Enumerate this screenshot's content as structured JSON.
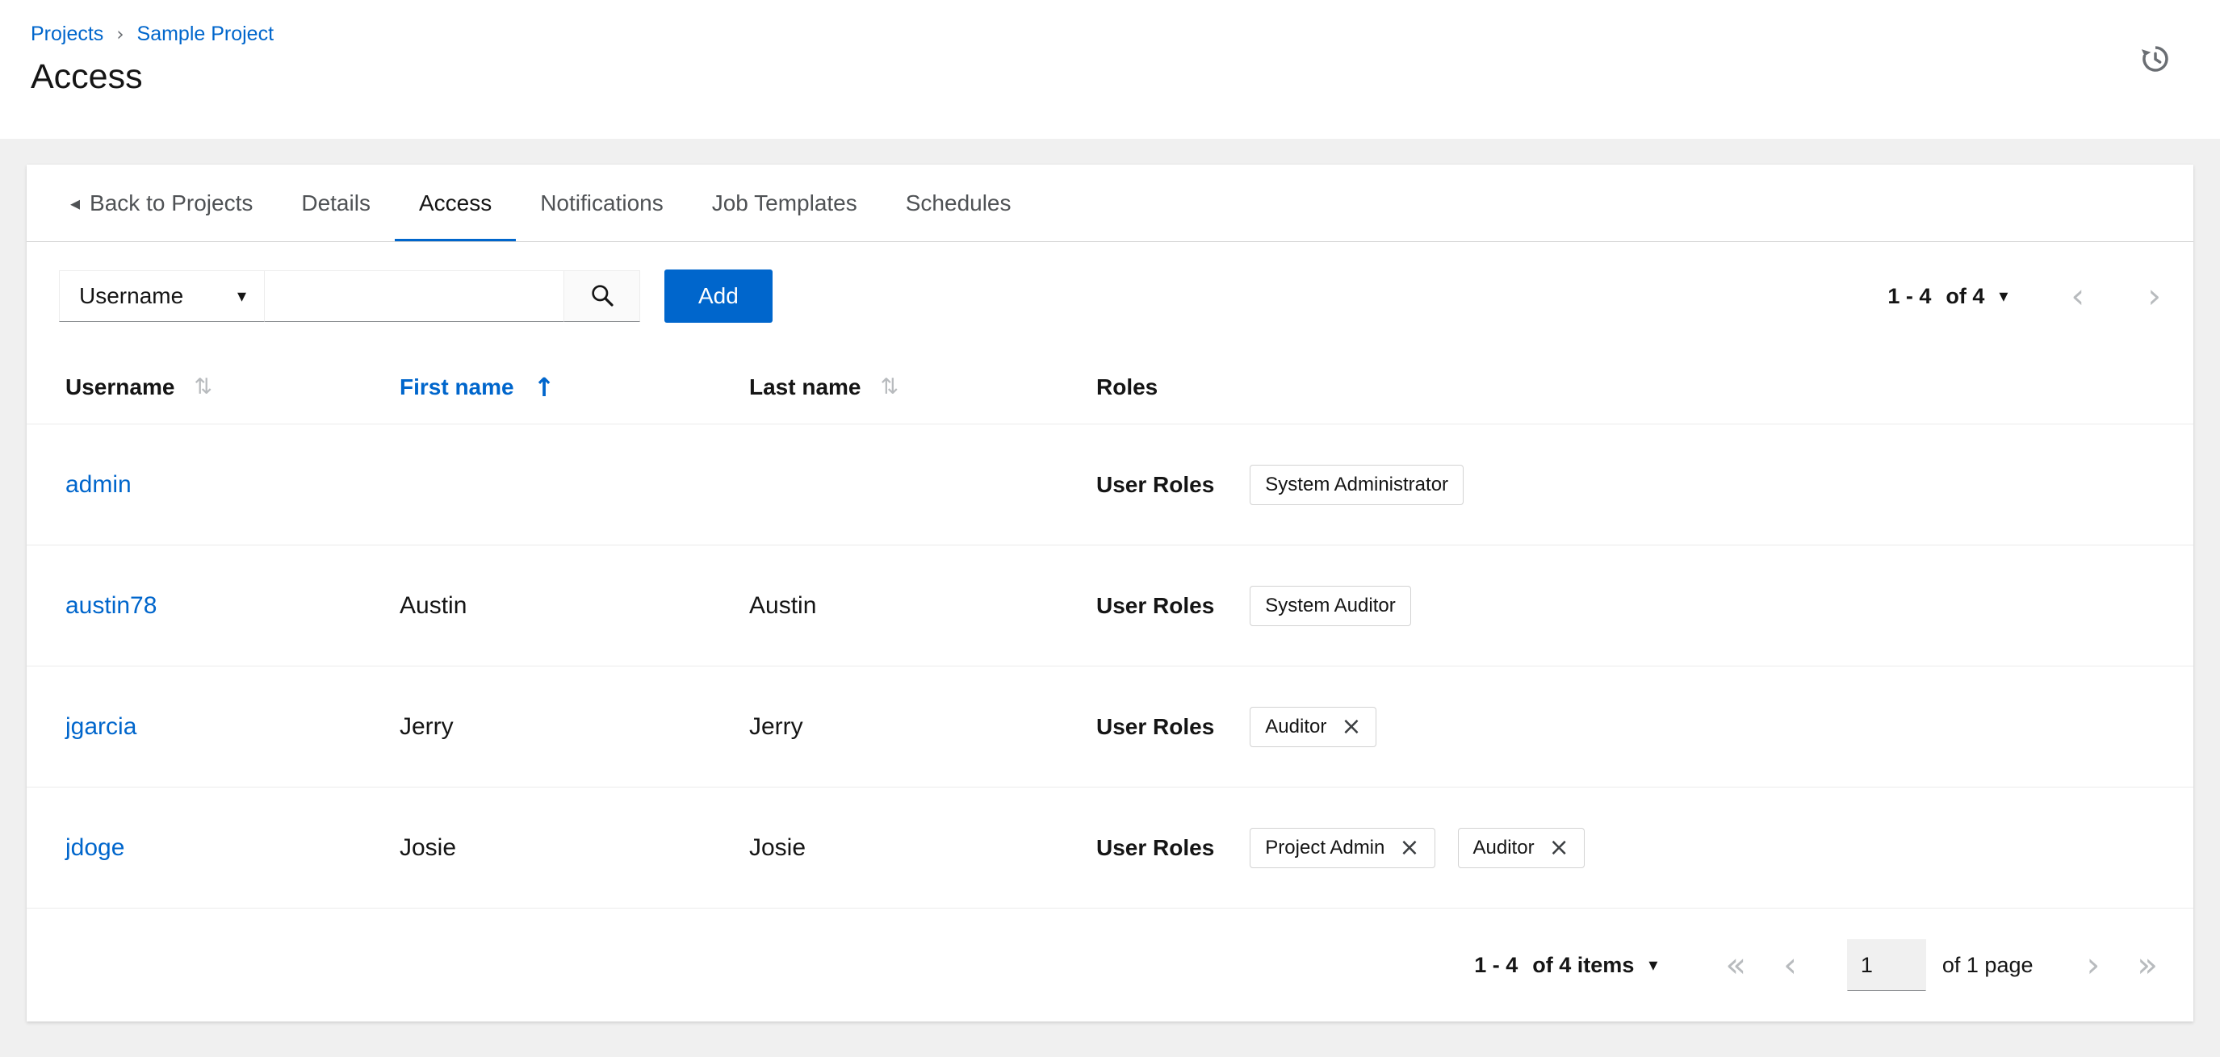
{
  "colors": {
    "accent": "#0066cc"
  },
  "icons": {
    "caret_down": "▾",
    "back": "◂",
    "chevron_left": "‹",
    "chevron_right": "›",
    "chevron_double_left": "«",
    "chevron_double_right": "»",
    "sort_both": "⇅",
    "sort_up": "↑",
    "close": "×",
    "breadcrumb_sep": "›"
  },
  "breadcrumb": {
    "items": [
      {
        "label": "Projects"
      },
      {
        "label": "Sample Project"
      }
    ]
  },
  "page": {
    "title": "Access"
  },
  "tabs": {
    "back_label": "Back to Projects",
    "items": [
      {
        "label": "Details"
      },
      {
        "label": "Access"
      },
      {
        "label": "Notifications"
      },
      {
        "label": "Job Templates"
      },
      {
        "label": "Schedules"
      }
    ],
    "active": "Access"
  },
  "toolbar": {
    "filter_selected": "Username",
    "search_value": "",
    "add_label": "Add",
    "pagination_range": "1 - 4",
    "pagination_total": "of 4"
  },
  "table": {
    "columns": {
      "username": "Username",
      "first_name": "First name",
      "last_name": "Last name",
      "roles": "Roles"
    },
    "sorted_column": "First name",
    "rows": [
      {
        "username": "admin",
        "first": "",
        "last": "",
        "roles_label": "User Roles",
        "chips": [
          {
            "label": "System Administrator",
            "removable": false
          }
        ]
      },
      {
        "username": "austin78",
        "first": "Austin",
        "last": "Austin",
        "roles_label": "User Roles",
        "chips": [
          {
            "label": "System Auditor",
            "removable": false
          }
        ]
      },
      {
        "username": "jgarcia",
        "first": "Jerry",
        "last": "Jerry",
        "roles_label": "User Roles",
        "chips": [
          {
            "label": "Auditor",
            "removable": true
          }
        ]
      },
      {
        "username": "jdoge",
        "first": "Josie",
        "last": "Josie",
        "roles_label": "User Roles",
        "chips": [
          {
            "label": "Project Admin",
            "removable": true
          },
          {
            "label": "Auditor",
            "removable": true
          }
        ]
      }
    ]
  },
  "footer": {
    "pagination_range": "1 - 4",
    "pagination_total": "of 4 items",
    "page_value": "1",
    "page_info": "of 1 page"
  }
}
